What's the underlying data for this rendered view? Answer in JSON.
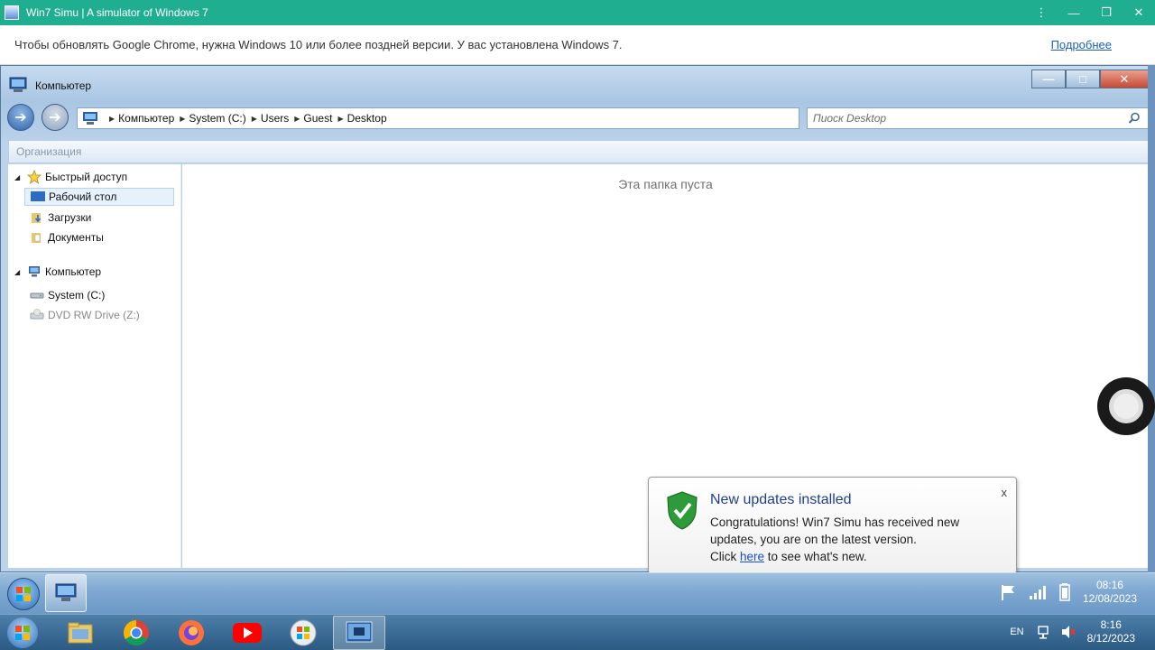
{
  "app_titlebar": {
    "title": "Win7 Simu | A simulator of Windows 7",
    "menu_icon": "kebab-menu-icon",
    "minimize_icon": "minimize-icon",
    "restore_icon": "restore-icon",
    "close_icon": "close-icon"
  },
  "infobar": {
    "message": "Чтобы обновлять Google Chrome, нужна Windows 10 или более поздней версии. У вас установлена Windows 7.",
    "link": "Подробнее"
  },
  "explorer": {
    "title": "Компьютер",
    "address": {
      "crumbs": [
        "Компьютер",
        "System (C:)",
        "Users",
        "Guest",
        "Desktop"
      ]
    },
    "search_placeholder": "Пиоск Desktop",
    "organize": "Организация",
    "empty_message": "Эта папка пуста",
    "nav": {
      "quick_access": "Быстрый доступ",
      "desktop": "Рабочий стол",
      "downloads": "Загрузки",
      "documents": "Документы",
      "computer": "Компьютер",
      "system_c": "System (C:)",
      "dvd": "DVD RW Drive (Z:)"
    }
  },
  "toast": {
    "title": "New updates installed",
    "body_line1": "Congratulations! Win7 Simu has received new",
    "body_line2": "updates, you are on the latest version.",
    "body_pre": "Click ",
    "link": "here",
    "body_post": " to see what's new.",
    "close": "x"
  },
  "w7taskbar": {
    "time": "08:16",
    "date": "12/08/2023"
  },
  "host_taskbar": {
    "lang": "EN",
    "time": "8:16",
    "date": "8/12/2023"
  },
  "colors": {
    "app_titlebar": "#1fae8f",
    "link": "#1a5fbf",
    "toast_title": "#1f3f8f"
  }
}
